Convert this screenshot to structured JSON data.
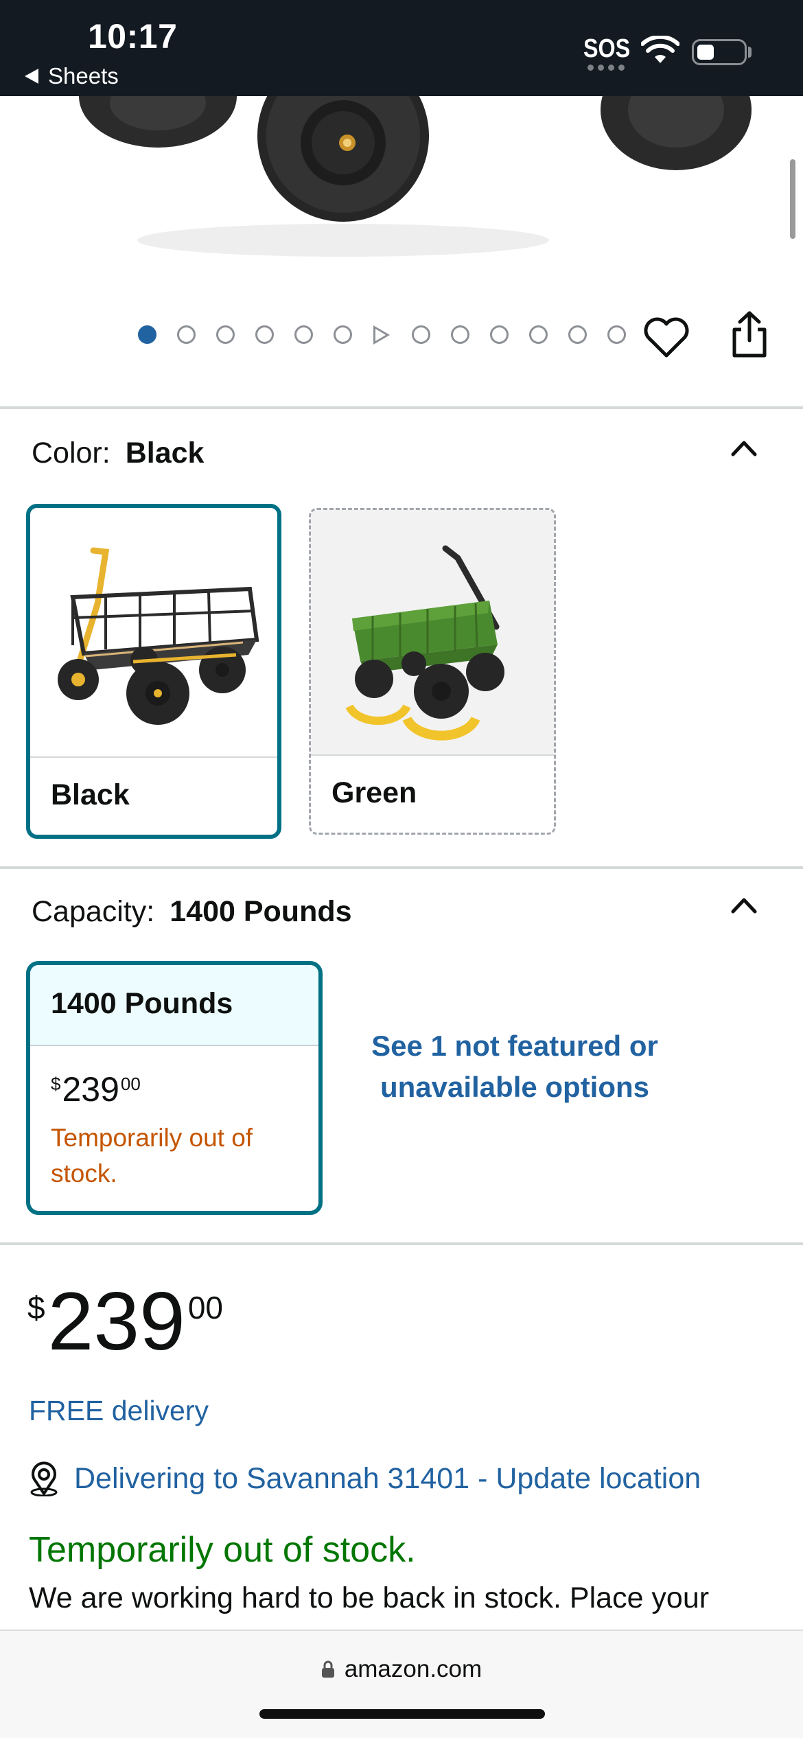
{
  "status_bar": {
    "time": "10:17",
    "back_label": "Sheets",
    "sos_label": "SOS",
    "icons": [
      "back-arrow-icon",
      "wifi-icon",
      "battery-icon"
    ]
  },
  "carousel": {
    "dot_count": 14,
    "active_index": 0,
    "video_index": 6,
    "icons": [
      "heart-icon",
      "share-icon"
    ]
  },
  "color_selector": {
    "label": "Color:",
    "selected_value": "Black",
    "options": [
      {
        "label": "Black",
        "selected": true
      },
      {
        "label": "Green",
        "selected": false
      }
    ]
  },
  "capacity_selector": {
    "label": "Capacity:",
    "selected_value": "1400 Pounds",
    "option": {
      "label": "1400 Pounds",
      "price_symbol": "$",
      "price_whole": "239",
      "price_fraction": "00",
      "stock_text": "Temporarily out of stock."
    },
    "see_more_text": "See 1 not featured or unavailable options"
  },
  "price": {
    "symbol": "$",
    "whole": "239",
    "fraction": "00"
  },
  "delivery": {
    "free_delivery_text": "FREE delivery",
    "location_text": "Delivering to Savannah 31401 - Update location"
  },
  "availability": {
    "title": "Temporarily out of stock.",
    "body": "We are working hard to be back in stock. Place your order and we'll email you when we have an"
  },
  "browser": {
    "url": "amazon.com"
  },
  "colors": {
    "status_bar_bg": "#131a22",
    "link_blue": "#2162a1",
    "selected_teal": "#007185",
    "out_of_stock_orange": "#c45500",
    "stock_green": "#007600"
  }
}
